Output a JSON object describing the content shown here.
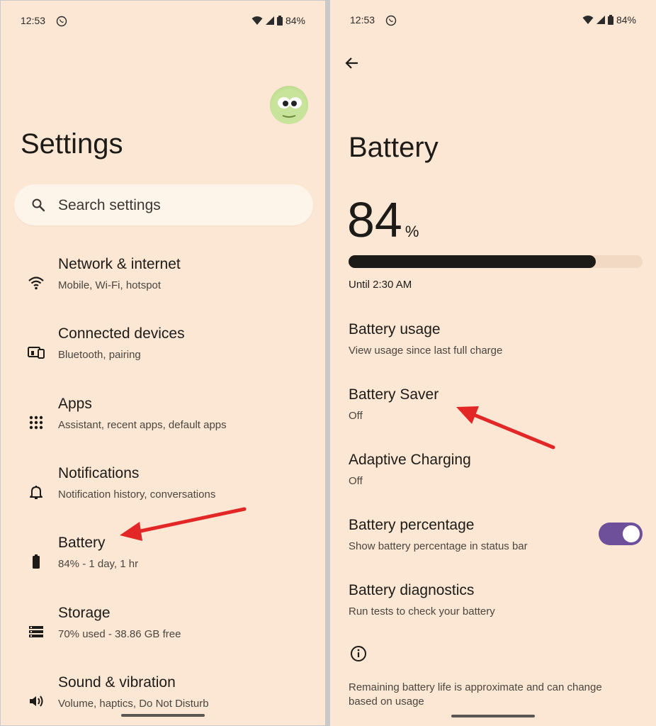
{
  "status_bar": {
    "time": "12:53",
    "battery": "84%"
  },
  "left": {
    "title": "Settings",
    "search_placeholder": "Search settings",
    "items": [
      {
        "title": "Network & internet",
        "subtitle": "Mobile, Wi-Fi, hotspot",
        "icon": "wifi-icon"
      },
      {
        "title": "Connected devices",
        "subtitle": "Bluetooth, pairing",
        "icon": "devices-icon"
      },
      {
        "title": "Apps",
        "subtitle": "Assistant, recent apps, default apps",
        "icon": "apps-grid-icon"
      },
      {
        "title": "Notifications",
        "subtitle": "Notification history, conversations",
        "icon": "bell-icon"
      },
      {
        "title": "Battery",
        "subtitle": "84% - 1 day, 1 hr",
        "icon": "battery-icon"
      },
      {
        "title": "Storage",
        "subtitle": "70% used - 38.86 GB free",
        "icon": "storage-icon"
      },
      {
        "title": "Sound & vibration",
        "subtitle": "Volume, haptics, Do Not Disturb",
        "icon": "speaker-icon"
      }
    ]
  },
  "right": {
    "title": "Battery",
    "level_value": "84",
    "level_unit": "%",
    "level_fraction": 0.84,
    "until": "Until 2:30 AM",
    "items": [
      {
        "title": "Battery usage",
        "subtitle": "View usage since last full charge"
      },
      {
        "title": "Battery Saver",
        "subtitle": "Off"
      },
      {
        "title": "Adaptive Charging",
        "subtitle": "Off"
      },
      {
        "title": "Battery percentage",
        "subtitle": "Show battery percentage in status bar",
        "toggle_on": true
      },
      {
        "title": "Battery diagnostics",
        "subtitle": "Run tests to check your battery"
      }
    ],
    "footer_note": "Remaining battery life is approximate and can change based on usage"
  },
  "colors": {
    "background": "#fbe7d3",
    "accent": "#6d4f9a",
    "arrow": "#e32626"
  }
}
